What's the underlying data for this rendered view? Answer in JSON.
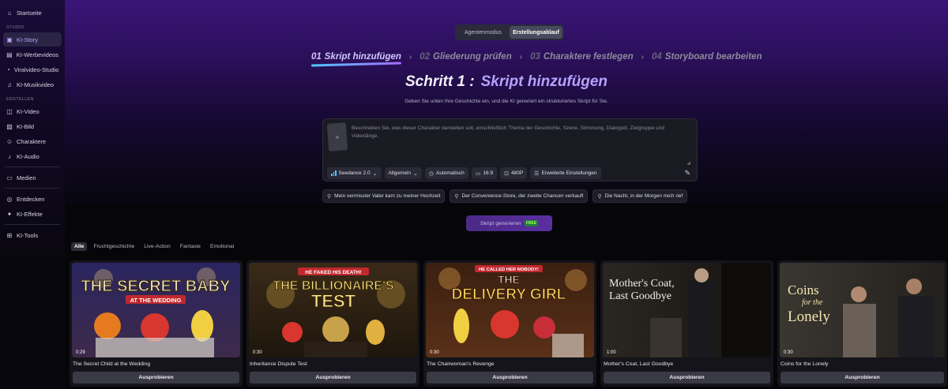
{
  "sidebar": {
    "home": {
      "label": "Startseite",
      "icon": "home-icon"
    },
    "studio_section": "STUDIO",
    "studio_items": [
      {
        "label": "KI-Story",
        "icon": "story-icon",
        "active": true
      },
      {
        "label": "KI-Werbevideos",
        "icon": "ad-video-icon"
      },
      {
        "label": "Viralvideo-Studio",
        "icon": "viral-icon"
      },
      {
        "label": "KI-Musikvideo",
        "icon": "music-icon"
      }
    ],
    "create_section": "ERSTELLEN",
    "create_items": [
      {
        "label": "KI-Video",
        "icon": "video-icon"
      },
      {
        "label": "KI-Bild",
        "icon": "image-icon"
      },
      {
        "label": "Charaktere",
        "icon": "character-icon"
      },
      {
        "label": "KI-Audio",
        "icon": "audio-icon"
      }
    ],
    "media": {
      "label": "Medien",
      "icon": "media-icon"
    },
    "discover": {
      "label": "Entdecken",
      "icon": "compass-icon"
    },
    "effects": {
      "label": "KI-Effekte",
      "icon": "sparkle-icon"
    },
    "tools": {
      "label": "KI-Tools",
      "icon": "tools-icon"
    }
  },
  "mode_toggle": {
    "options": [
      "Agentenmodus",
      "Erstellungsablauf"
    ],
    "selected": "Erstellungsablauf"
  },
  "steps": [
    {
      "num": "01",
      "label": "Skript hinzufügen",
      "active": true
    },
    {
      "num": "02",
      "label": "Gliederung prüfen"
    },
    {
      "num": "03",
      "label": "Charaktere festlegen"
    },
    {
      "num": "04",
      "label": "Storyboard bearbeiten"
    }
  ],
  "heading": {
    "prefix": "Schritt 1 :",
    "highlight": "Skript hinzufügen"
  },
  "subheading": "Geben Sie unten Ihre Geschichte ein, und die KI generiert ein strukturiertes Skript für Sie.",
  "composer": {
    "placeholder": "Beschreiben Sie, was dieser Charakter darstellen soll, einschließlich Thema der Geschichte, Szene, Stimmung, Dialogstil, Zielgruppe und Videolänge.",
    "toolbar": {
      "model": "Seedance 2.0",
      "genre": "Allgemein",
      "duration": "Automatisch",
      "aspect": "16:9",
      "resolution": "480P",
      "advanced": "Erweiterte Einstellungen"
    }
  },
  "suggestions": [
    "Mein vermisster Vater kam zu meiner Hochzeit",
    "Der Convenience-Store, der zweite Chancen verkauft",
    "Die Nacht, in der Morgen mich rief"
  ],
  "generate": {
    "label": "Skript generieren",
    "badge": "FREE"
  },
  "filters": [
    "Alle",
    "Fruchtgeschichte",
    "Live-Action",
    "Fantasie",
    "Emotional"
  ],
  "active_filter": "Alle",
  "cards": [
    {
      "title": "The Secret Child at the Wedding",
      "duration": "0:29",
      "art_title": "THE SECRET BABY",
      "art_sub": "AT THE WEDDING",
      "button": "Ausprobieren"
    },
    {
      "title": "Inheritance Dispute Test",
      "duration": "0:30",
      "art_title": "THE BILLIONAIRE'S",
      "art_title2": "TEST",
      "art_sub": "HE FAKED HIS DEATH!",
      "button": "Ausprobieren"
    },
    {
      "title": "The Chairwoman's Revenge",
      "duration": "0:30",
      "art_title": "THE",
      "art_title2": "DELIVERY GIRL",
      "art_sub": "HE CALLED HER NOBODY!",
      "button": "Ausprobieren"
    },
    {
      "title": "Mother's Coat, Last Goodbye",
      "duration": "1:00",
      "art_title": "Mother's Coat,",
      "art_title2": "Last Goodbye",
      "button": "Ausprobieren"
    },
    {
      "title": "Coins for the Lonely",
      "duration": "0:30",
      "art_title": "Coins",
      "art_mid": "for the",
      "art_title2": "Lonely",
      "button": "Ausprobieren"
    }
  ],
  "colors": {
    "accent": "#b6a2ff",
    "sidebar_active": "#2a2545",
    "button": "#3a3a44"
  }
}
